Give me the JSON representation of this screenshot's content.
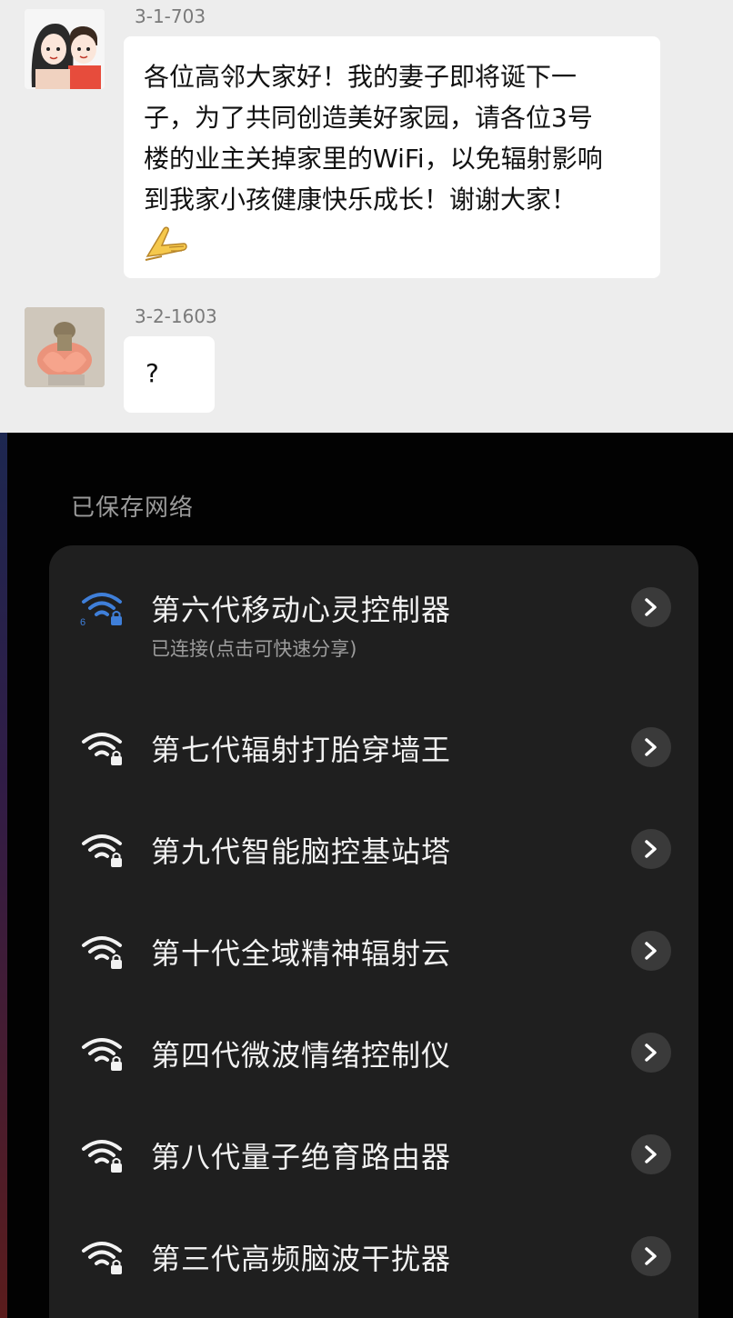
{
  "chat": {
    "messages": [
      {
        "sender": "3-1-703",
        "lines": [
          "各位高邻大家好！我的妻子即将诞下一",
          "子，为了共同创造美好家园，请各位3号",
          "楼的业主关掉家里的WiFi，以免辐射影响",
          "到我家小孩健康快乐成长！谢谢大家！"
        ],
        "emoji": "folded-hands-icon"
      },
      {
        "sender": "3-2-1603",
        "text": "?"
      }
    ]
  },
  "wifi": {
    "section_title": "已保存网络",
    "networks": [
      {
        "name": "第六代移动心灵控制器",
        "status": "已连接(点击可快速分享)",
        "connected": true,
        "icon": "wifi-6-lock-icon"
      },
      {
        "name": "第七代辐射打胎穿墙王",
        "connected": false,
        "icon": "wifi-lock-icon"
      },
      {
        "name": "第九代智能脑控基站塔",
        "connected": false,
        "icon": "wifi-lock-icon"
      },
      {
        "name": "第十代全域精神辐射云",
        "connected": false,
        "icon": "wifi-lock-icon"
      },
      {
        "name": "第四代微波情绪控制仪",
        "connected": false,
        "icon": "wifi-lock-icon"
      },
      {
        "name": "第八代量子绝育路由器",
        "connected": false,
        "icon": "wifi-lock-icon"
      },
      {
        "name": "第三代高频脑波干扰器",
        "connected": false,
        "icon": "wifi-lock-icon"
      }
    ],
    "colors": {
      "connected": "#3f7fd9",
      "default": "#f2f2f2"
    }
  }
}
